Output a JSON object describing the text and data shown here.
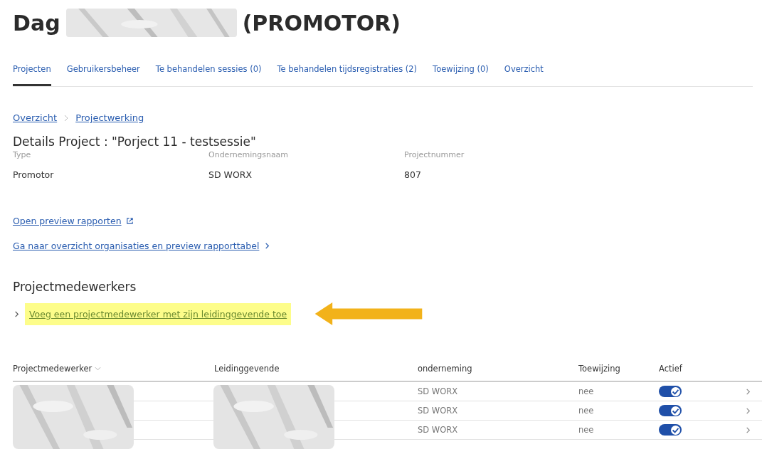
{
  "header": {
    "greeting": "Dag",
    "role": "(PROMOTOR)"
  },
  "tabs": [
    {
      "label": "Projecten",
      "selected": true
    },
    {
      "label": "Gebruikersbeheer",
      "selected": false
    },
    {
      "label": "Te behandelen sessies (0)",
      "selected": false
    },
    {
      "label": "Te behandelen tijdsregistraties (2)",
      "selected": false
    },
    {
      "label": "Toewijzing (0)",
      "selected": false
    },
    {
      "label": "Overzicht",
      "selected": false
    }
  ],
  "breadcrumb": [
    "Overzicht",
    "Projectwerking"
  ],
  "details": {
    "title": "Details Project : \"Porject 11 - testsessie\"",
    "fields": [
      {
        "label": "Type",
        "value": "Promotor"
      },
      {
        "label": "Ondernemingsnaam",
        "value": "SD WORX"
      },
      {
        "label": "Projectnummer",
        "value": "807"
      }
    ]
  },
  "links": [
    {
      "text": "Open preview rapporten",
      "kind": "external"
    },
    {
      "text": "Ga naar overzicht organisaties en preview rapporttabel",
      "kind": "chevron"
    }
  ],
  "section": {
    "title": "Projectmedewerkers",
    "add_link": "Voeg een projectmedewerker met zijn leidinggevende toe"
  },
  "table": {
    "columns": [
      {
        "label": "Projectmedewerker",
        "sortable": true
      },
      {
        "label": "Leidinggevende",
        "sortable": false
      },
      {
        "label": "onderneming",
        "sortable": false
      },
      {
        "label": "Toewijzing",
        "sortable": false
      },
      {
        "label": "Actief",
        "sortable": false
      }
    ],
    "rows": [
      {
        "onderneming": "SD WORX",
        "toewijzing": "nee",
        "actief": true
      },
      {
        "onderneming": "SD WORX",
        "toewijzing": "nee",
        "actief": true
      },
      {
        "onderneming": "SD WORX",
        "toewijzing": "nee",
        "actief": true
      }
    ]
  }
}
